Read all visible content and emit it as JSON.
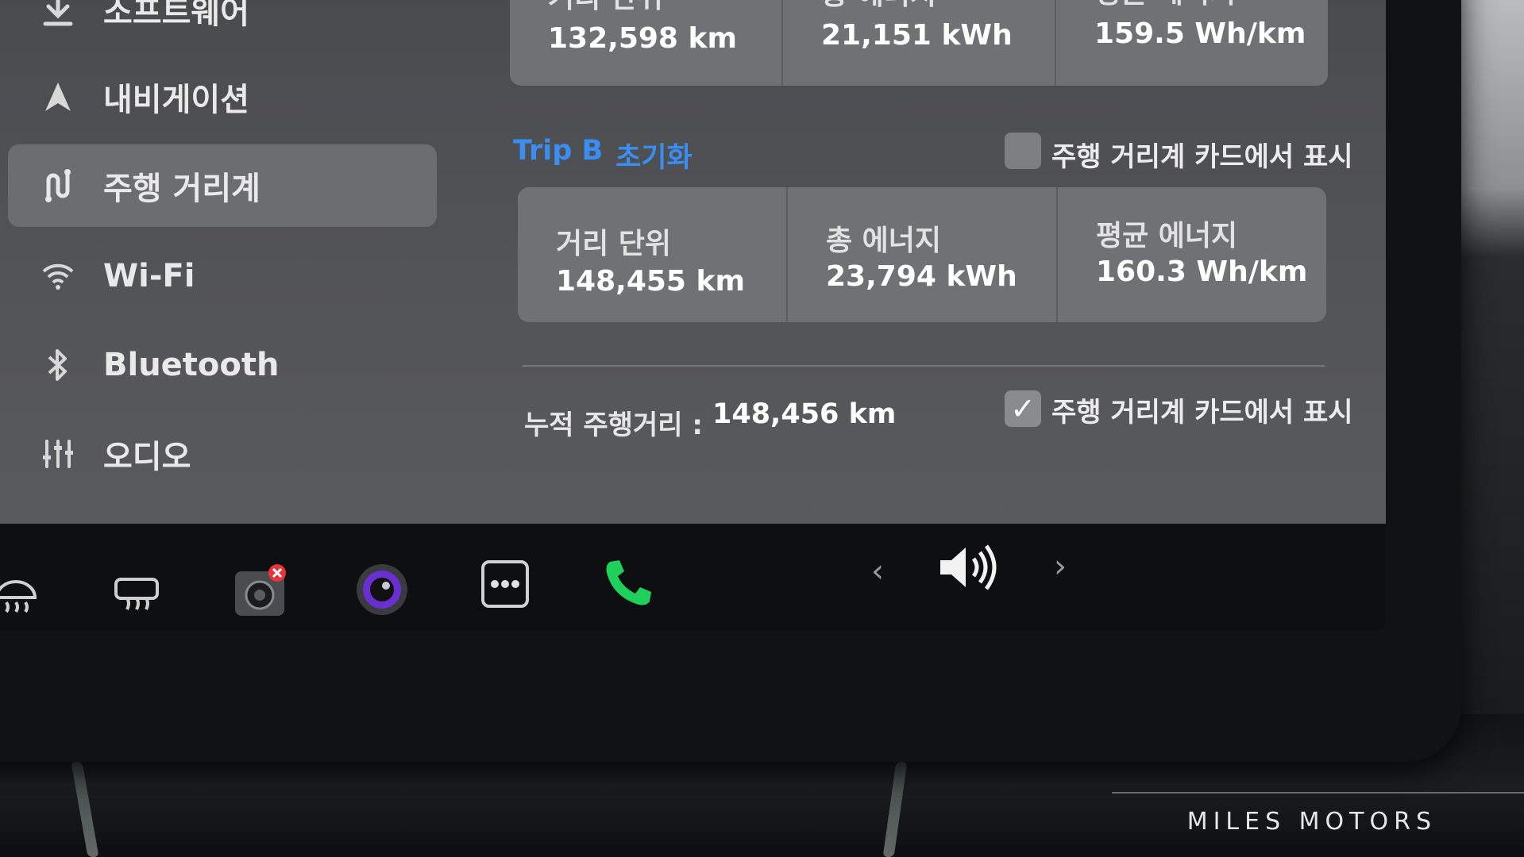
{
  "sidebar": {
    "items": [
      {
        "label": "소프트웨어",
        "icon": "download-icon"
      },
      {
        "label": "내비게이션",
        "icon": "navigation-arrow-icon"
      },
      {
        "label": "주행 거리계",
        "icon": "trips-icon",
        "active": true
      },
      {
        "label": "Wi-Fi",
        "icon": "wifi-icon"
      },
      {
        "label": "Bluetooth",
        "icon": "bluetooth-icon"
      },
      {
        "label": "오디오",
        "icon": "audio-sliders-icon"
      }
    ]
  },
  "trip_a": {
    "cells": [
      {
        "label": "거리 단위",
        "value": "132,598 km"
      },
      {
        "label": "총 에너지",
        "value": "21,151 kWh"
      },
      {
        "label": "평균 에너지",
        "value": "159.5 Wh/km"
      }
    ]
  },
  "trip_b": {
    "title": "Trip B",
    "reset_label": "초기화",
    "show_on_card_label": "주행 거리계 카드에서 표시",
    "show_on_card_checked": false,
    "cells": [
      {
        "label": "거리 단위",
        "value": "148,455 km"
      },
      {
        "label": "총 에너지",
        "value": "23,794 kWh"
      },
      {
        "label": "평균 에너지",
        "value": "160.3 Wh/km"
      }
    ]
  },
  "odometer": {
    "label": "누적 주행거리 :",
    "value": "148,456 km",
    "show_on_card_label": "주행 거리계 카드에서 표시",
    "show_on_card_checked": true,
    "check_mark": "✓"
  },
  "taskbar": {
    "prev_symbol": "‹",
    "next_symbol": "›"
  },
  "watermark": "MILES MOTORS",
  "colors": {
    "accent_link": "#3a8ef2",
    "phone_green": "#1fd15a",
    "badge_red": "#e8323c"
  }
}
